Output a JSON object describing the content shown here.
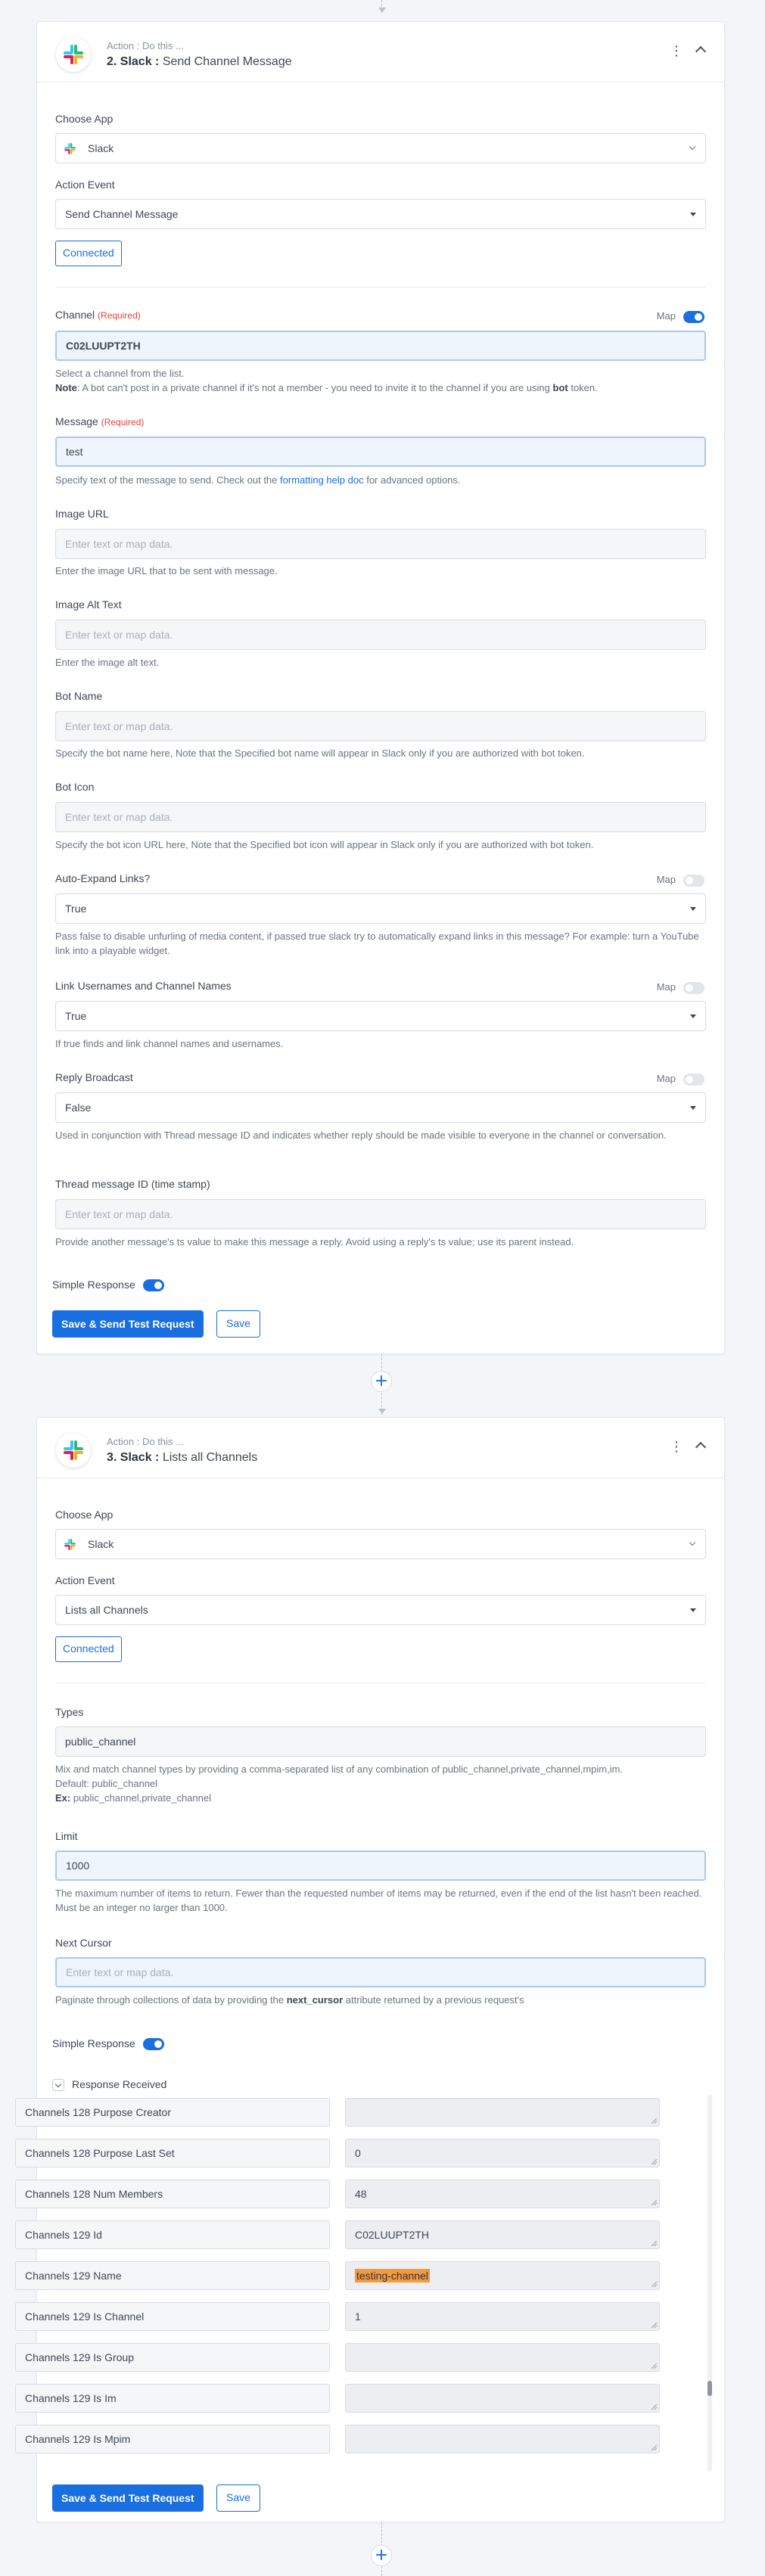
{
  "step2": {
    "subtitle": "Action : Do this ...",
    "title_bold": "2. Slack :",
    "title_rest": "Send Channel Message",
    "choose_app_label": "Choose App",
    "app_value": "Slack",
    "action_event_label": "Action Event",
    "action_event_value": "Send Channel Message",
    "connected_label": "Connected",
    "channel": {
      "label": "Channel",
      "required": "(Required)",
      "map_label": "Map",
      "value": "C02LUUPT2TH",
      "help_line1": "Select a channel from the list.",
      "help_note_bold": "Note",
      "help_note_text": ": A bot can't post in a private channel if it's not a member - you need to invite it to the channel if you are using ",
      "help_note_bot": "bot",
      "help_note_end": " token."
    },
    "message": {
      "label": "Message",
      "required": "(Required)",
      "value": "test",
      "help_pre": "Specify text of the message to send. Check out the ",
      "help_link": "formatting help doc",
      "help_post": " for advanced options."
    },
    "image_url": {
      "label": "Image URL",
      "placeholder": "Enter text or map data.",
      "help": "Enter the image URL that to be sent with message."
    },
    "image_alt": {
      "label": "Image Alt Text",
      "placeholder": "Enter text or map data.",
      "help": "Enter the image alt text."
    },
    "bot_name": {
      "label": "Bot Name",
      "placeholder": "Enter text or map data.",
      "help": "Specify the bot name here, Note that the Specified bot name will appear in Slack only if you are authorized with bot token."
    },
    "bot_icon": {
      "label": "Bot Icon",
      "placeholder": "Enter text or map data.",
      "help": "Specify the bot icon URL here, Note that the Specified bot icon will appear in Slack only if you are authorized with bot token."
    },
    "auto_expand": {
      "label": "Auto-Expand Links?",
      "map_label": "Map",
      "value": "True",
      "help": "Pass false to disable unfurling of media content, if passed true slack try to automatically expand links in this message? For example: turn a YouTube link into a playable widget."
    },
    "link_names": {
      "label": "Link Usernames and Channel Names",
      "map_label": "Map",
      "value": "True",
      "help": "If true finds and link channel names and usernames."
    },
    "reply_broadcast": {
      "label": "Reply Broadcast",
      "map_label": "Map",
      "value": "False",
      "help": "Used in conjunction with Thread message ID and indicates whether reply should be made visible to everyone in the channel or conversation."
    },
    "thread_id": {
      "label": "Thread message ID (time stamp)",
      "placeholder": "Enter text or map data.",
      "help": "Provide another message's ts value to make this message a reply. Avoid using a reply's ts value; use its parent instead."
    },
    "simple_response_label": "Simple Response",
    "save_test_label": "Save & Send Test Request",
    "save_label": "Save"
  },
  "step3": {
    "subtitle": "Action : Do this ...",
    "title_bold": "3. Slack :",
    "title_rest": "Lists all Channels",
    "choose_app_label": "Choose App",
    "app_value": "Slack",
    "action_event_label": "Action Event",
    "action_event_value": "Lists all Channels",
    "connected_label": "Connected",
    "types": {
      "label": "Types",
      "value": "public_channel",
      "help_line1": "Mix and match channel types by providing a comma-separated list of any combination of public_channel,private_channel,mpim,im.",
      "help_line2": "Default: public_channel",
      "help_ex_bold": "Ex:",
      "help_ex_text": " public_channel,private_channel"
    },
    "limit": {
      "label": "Limit",
      "value": "1000",
      "help": "The maximum number of items to return. Fewer than the requested number of items may be returned, even if the end of the list hasn't been reached. Must be an integer no larger than 1000."
    },
    "next_cursor": {
      "label": "Next Cursor",
      "placeholder": "Enter text or map data.",
      "help_pre": "Paginate through collections of data by providing the ",
      "help_bold": "next_cursor",
      "help_post": " attribute returned by a previous request's"
    },
    "simple_response_label": "Simple Response",
    "response_received_label": "Response Received",
    "response_rows": [
      {
        "key": "Channels 128 Purpose Creator",
        "value": ""
      },
      {
        "key": "Channels 128 Purpose Last Set",
        "value": "0"
      },
      {
        "key": "Channels 128 Num Members",
        "value": "48"
      },
      {
        "key": "Channels 129 Id",
        "value": "C02LUUPT2TH"
      },
      {
        "key": "Channels 129 Name",
        "value": "testing-channel"
      },
      {
        "key": "Channels 129 Is Channel",
        "value": "1"
      },
      {
        "key": "Channels 129 Is Group",
        "value": ""
      },
      {
        "key": "Channels 129 Is Im",
        "value": ""
      },
      {
        "key": "Channels 129 Is Mpim",
        "value": ""
      }
    ],
    "save_test_label": "Save & Send Test Request",
    "save_label": "Save"
  },
  "add_step_symbol": "+",
  "colors": {
    "accent": "#1a6fe0",
    "required": "#e0443e",
    "highlight": "#f59a3b"
  },
  "icons": {
    "app_logo": "slack-logo",
    "menu": "kebab-icon",
    "collapse": "chevron-up-icon"
  }
}
